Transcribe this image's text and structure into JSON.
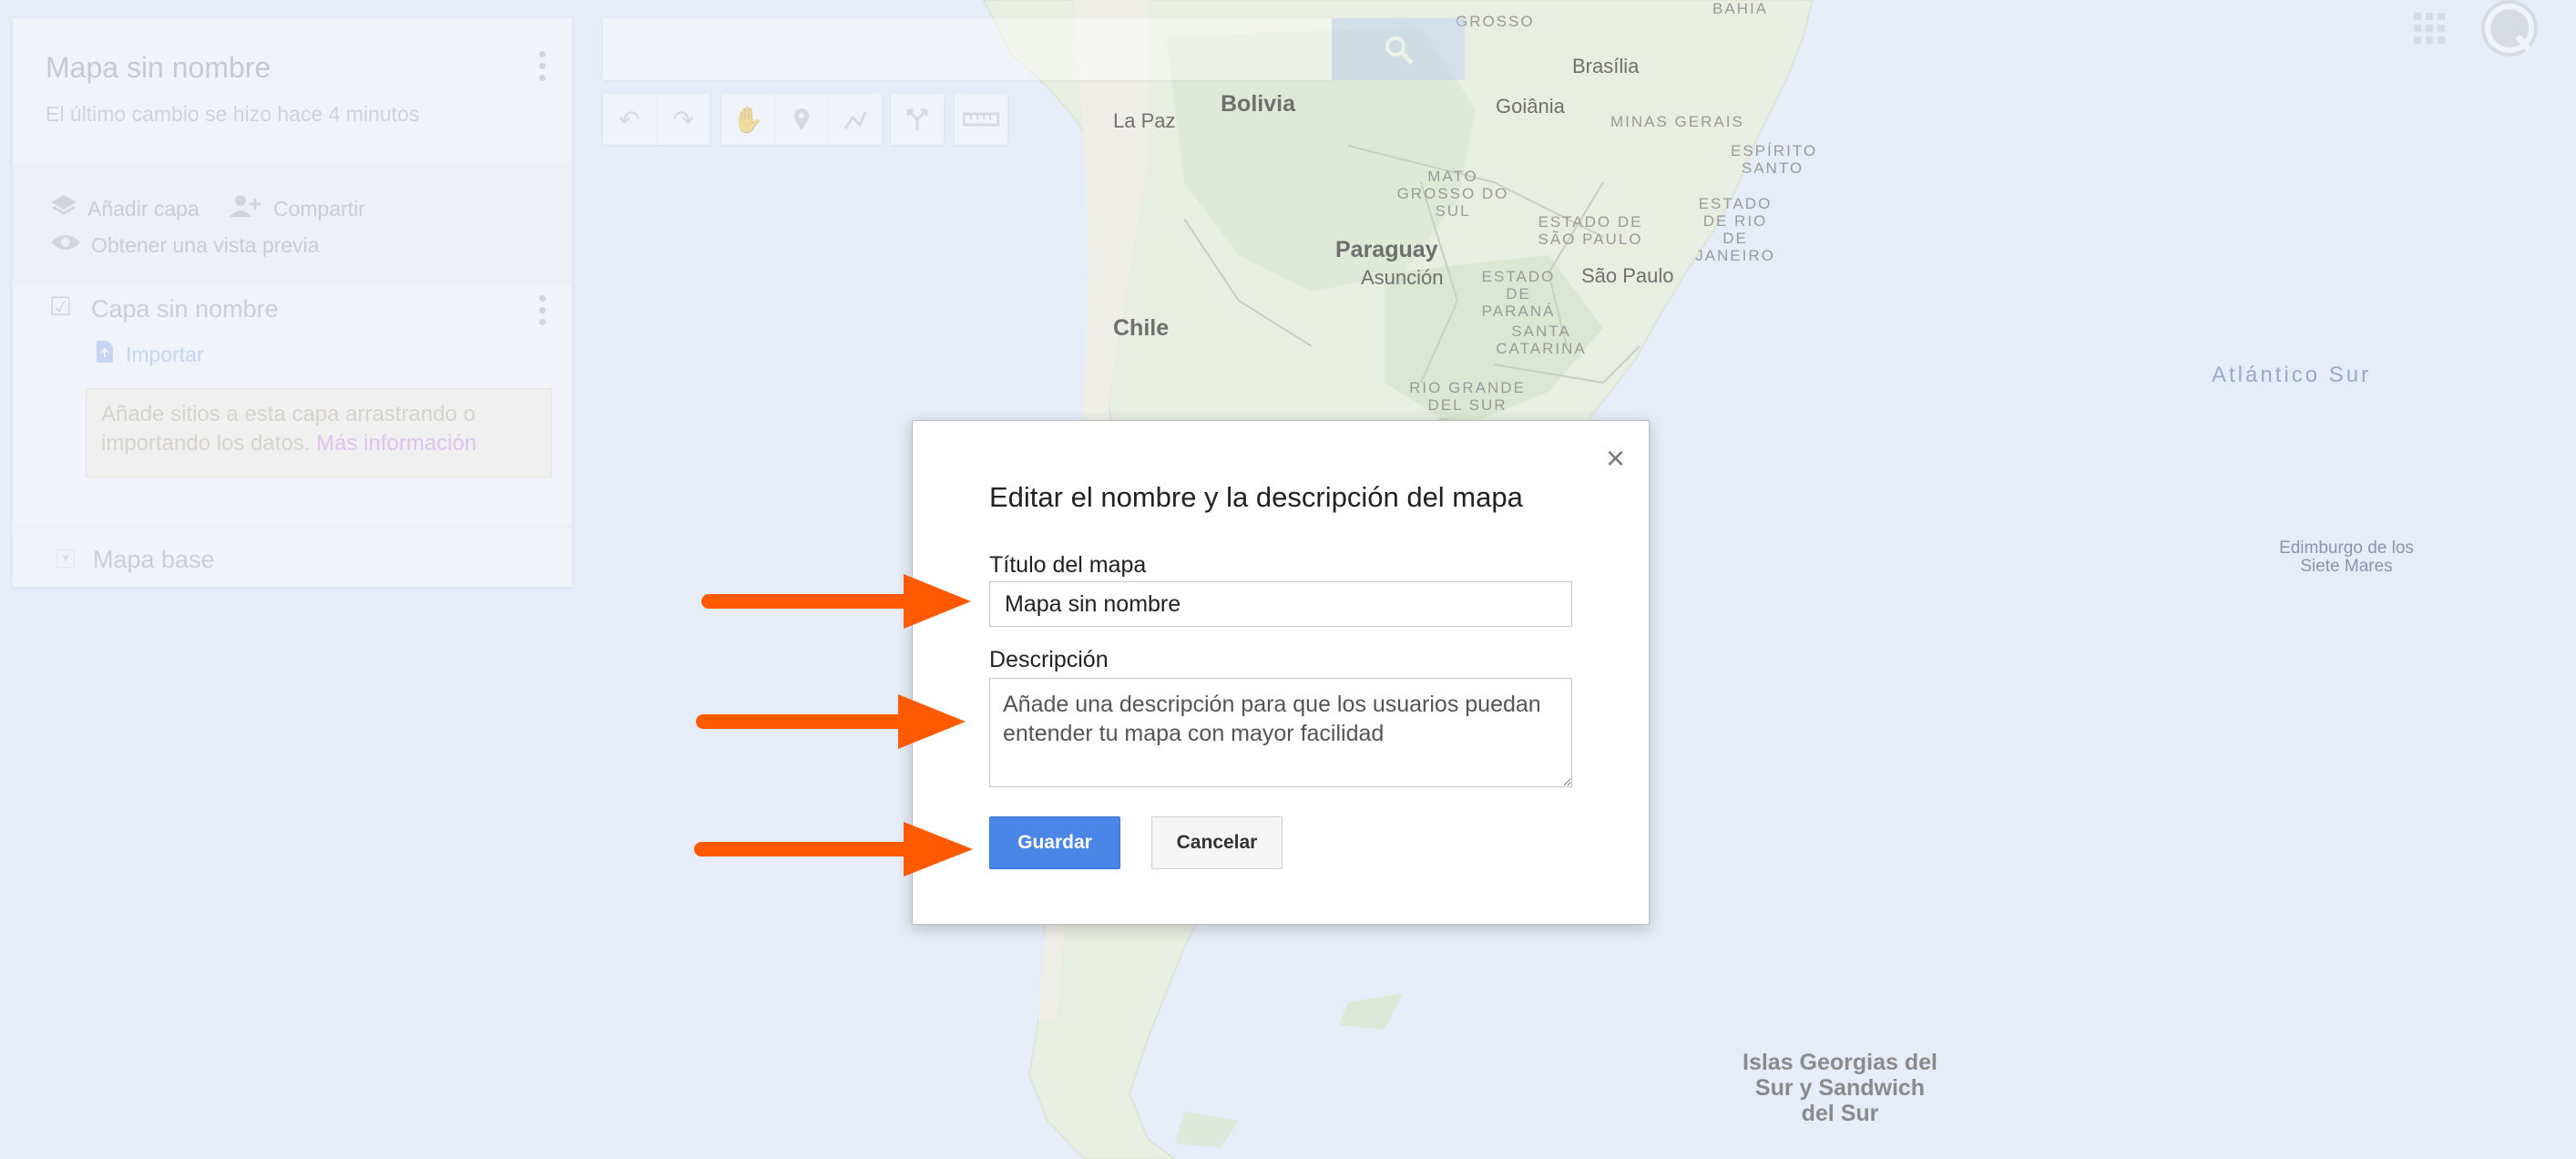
{
  "map": {
    "countries": [
      "Bolivia",
      "Paraguay",
      "Chile"
    ],
    "cities": [
      "La Paz",
      "Brasília",
      "Goiânia",
      "Asunción",
      "São Paulo"
    ],
    "regions": {
      "bahia": "BAHIA",
      "minas": "MINAS GERAIS",
      "espirito": "ESPÍRITO SANTO",
      "mato": "MATO GROSSO DO SUL",
      "estado_sp": "ESTADO DE SÃO PAULO",
      "estado_rj": "ESTADO DE RIO DE JANEIRO",
      "estado_pr": "ESTADO DE PARANÁ",
      "santa": "SANTA CATARINA",
      "rio_grande": "RIO GRANDE DEL SUR",
      "grosso": "GROSSO"
    },
    "ocean": "Atlántico Sur",
    "edimburgo": "Edimburgo de los Siete Mares",
    "islas": "Islas Georgias del Sur y Sandwich del Sur"
  },
  "panel": {
    "title": "Mapa sin nombre",
    "subtitle": "El último cambio se hizo hace 4 minutos",
    "add_layer": "Añadir capa",
    "share": "Compartir",
    "preview": "Obtener una vista previa",
    "layer_name": "Capa sin nombre",
    "import": "Importar",
    "info_text": "Añade sitios a esta capa arrastrando o importando los datos.",
    "info_link": "Más información",
    "base_map": "Mapa base"
  },
  "dialog": {
    "heading": "Editar el nombre y la descripción del mapa",
    "title_label": "Título del mapa",
    "title_value": "Mapa sin nombre",
    "description_label": "Descripción",
    "description_placeholder": "Añade una descripción para que los usuarios puedan entender tu mapa con mayor facilidad",
    "save": "Guardar",
    "cancel": "Cancelar",
    "close": "×"
  },
  "colors": {
    "ocean": "#e6ecf8",
    "land": "#e9eee4",
    "arrow": "#ff5a00",
    "save_button": "#4a86e8"
  }
}
